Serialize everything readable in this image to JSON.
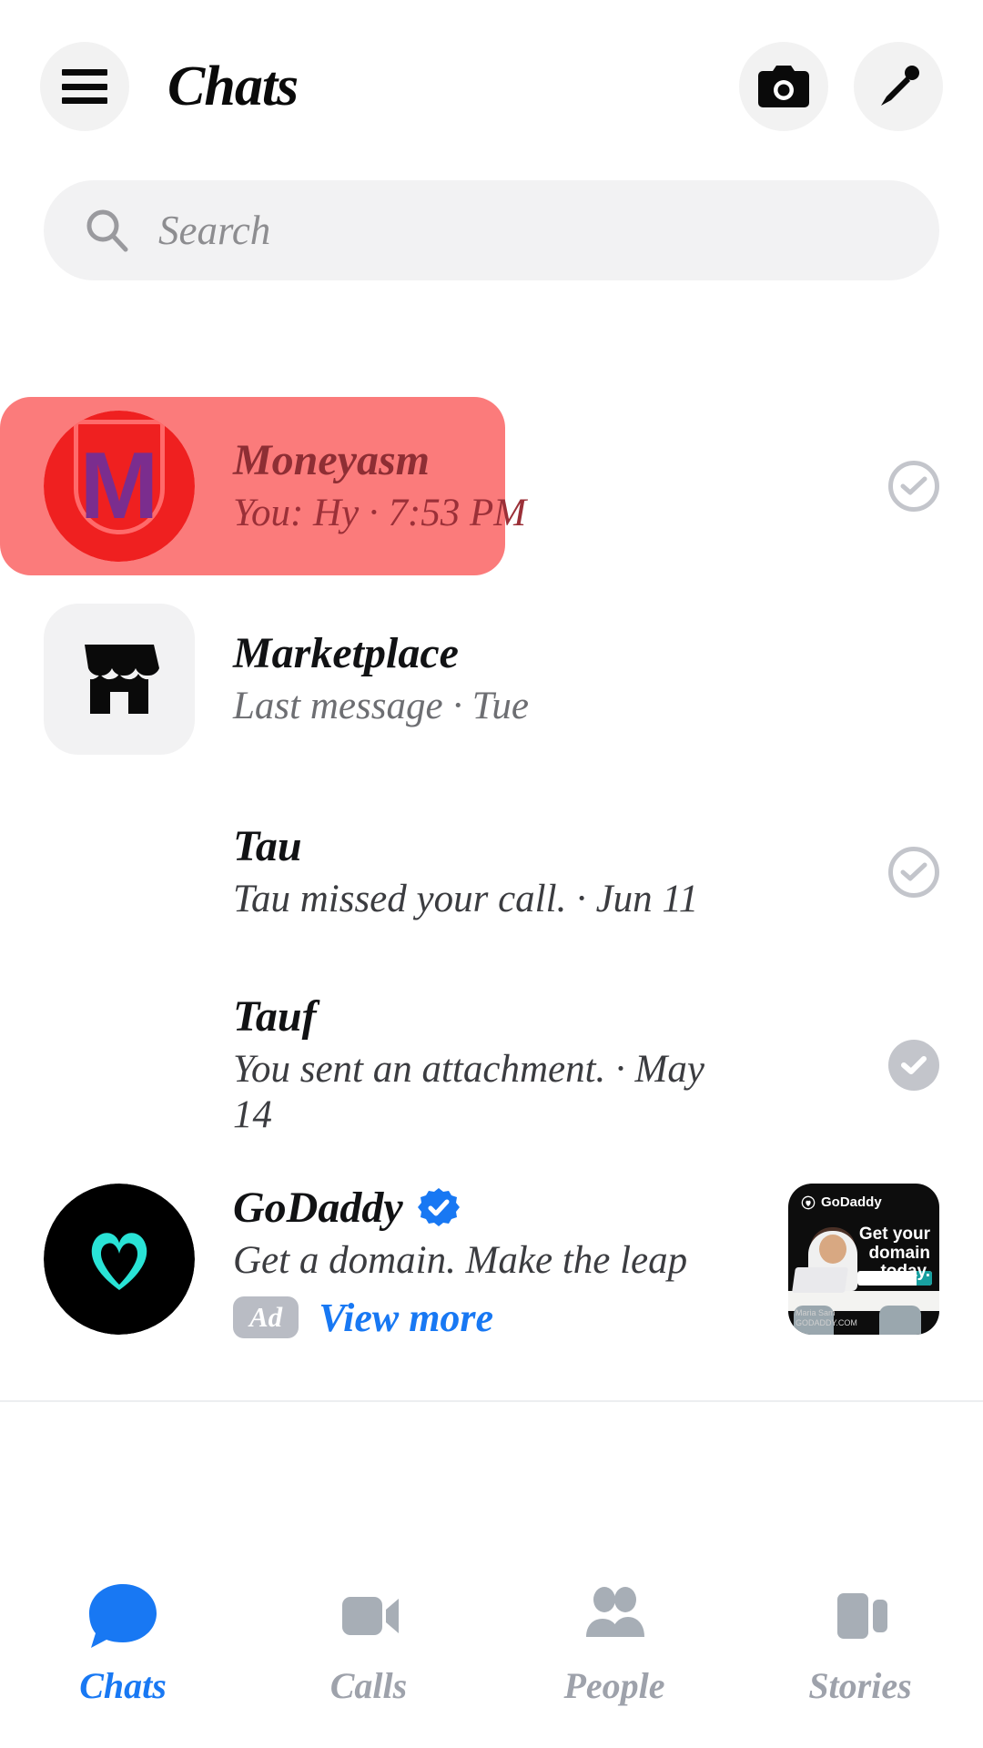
{
  "header": {
    "menu_icon": "hamburger-menu-icon",
    "title": "Chats",
    "camera_icon": "camera-icon",
    "compose_icon": "pencil-edit-icon"
  },
  "search": {
    "icon": "search-icon",
    "placeholder": "Search",
    "value": ""
  },
  "chats": [
    {
      "name": "Moneyasm",
      "preview": "You: Hy · 7:53 PM",
      "avatar_type": "shield-logo",
      "avatar_letter": "M",
      "status_icon": "check-circle-outline-icon",
      "highlighted": true,
      "highlight_color": "#fb7b7b"
    },
    {
      "name": "Marketplace",
      "preview": "Last message · Tue",
      "avatar_type": "marketplace-storefront",
      "status_icon": "none",
      "highlighted": false
    },
    {
      "name": "Tau",
      "preview": "Tau missed your call. · Jun 11",
      "avatar_type": "blank",
      "status_icon": "check-circle-outline-icon",
      "highlighted": false
    },
    {
      "name": "Tauf",
      "preview": "You sent an attachment. · May 14",
      "avatar_type": "blank",
      "status_icon": "check-circle-filled-icon",
      "highlighted": false
    }
  ],
  "ad": {
    "advertiser": "GoDaddy",
    "verified_icon": "verified-badge-icon",
    "headline": "Get a domain. Make the leap",
    "badge_label": "Ad",
    "cta_label": "View more",
    "link_color": "#1878f3",
    "thumbnail": {
      "logo_text": "GoDaddy",
      "headline_line1": "Get your",
      "headline_line2": "domain today.",
      "credit_line1": "Maria Sam",
      "credit_line2": "GODADDY.COM"
    }
  },
  "bottom_nav": {
    "active_color": "#1878f3",
    "inactive_color": "#9ea2ab",
    "items": [
      {
        "label": "Chats",
        "icon": "chat-bubble-icon",
        "active": true
      },
      {
        "label": "Calls",
        "icon": "video-camera-icon",
        "active": false
      },
      {
        "label": "People",
        "icon": "people-icon",
        "active": false
      },
      {
        "label": "Stories",
        "icon": "stories-cards-icon",
        "active": false
      }
    ]
  }
}
